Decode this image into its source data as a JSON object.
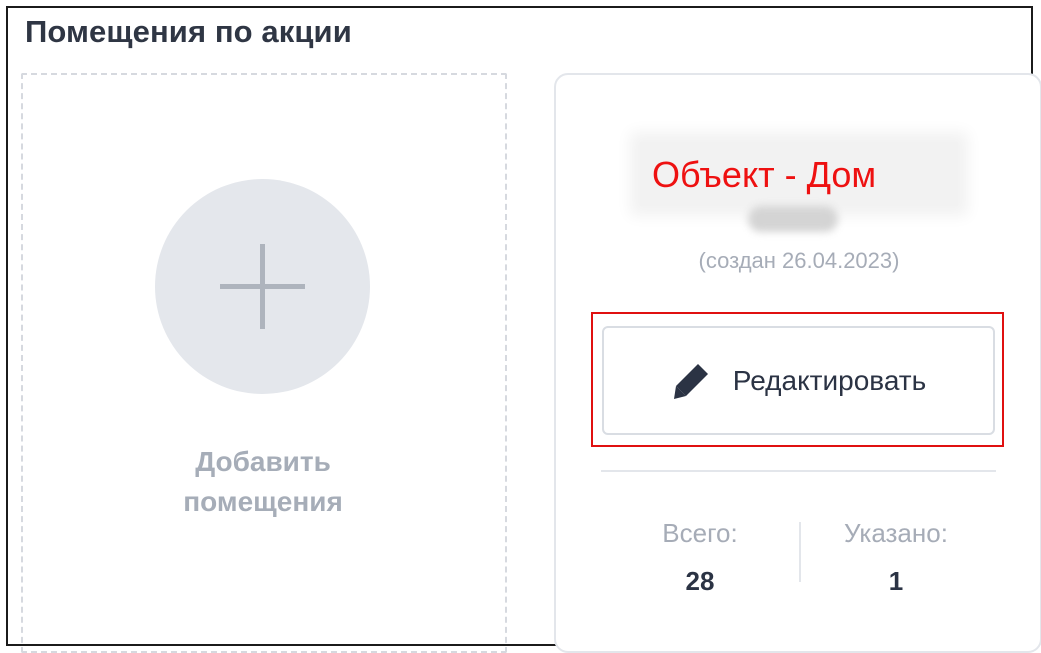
{
  "section": {
    "title": "Помещения по акции"
  },
  "add_card": {
    "label": "Добавить помещения",
    "icon": "plus-icon"
  },
  "object_card": {
    "title": "Объект - Дом",
    "created": "(создан 26.04.2023)",
    "edit_button": {
      "label": "Редактировать",
      "icon": "pencil-icon"
    },
    "stats": {
      "total": {
        "label": "Всего:",
        "value": "28"
      },
      "specified": {
        "label": "Указано:",
        "value": "1"
      }
    }
  },
  "colors": {
    "highlight": "#e01010",
    "title_text": "#ee1111",
    "muted_text": "#a6acb7",
    "primary_text": "#2b3344",
    "add_circle": "#e4e7ec"
  }
}
